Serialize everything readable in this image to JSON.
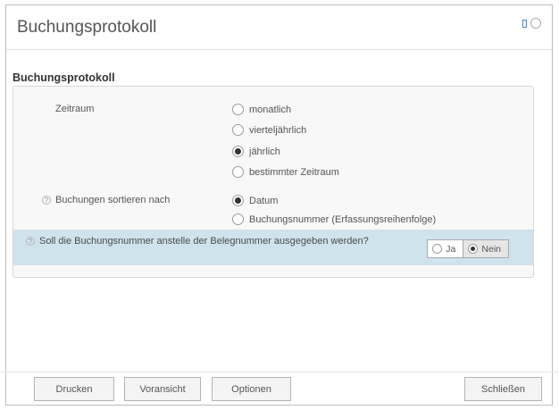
{
  "window": {
    "title": "Buchungsprotokoll"
  },
  "section": {
    "title": "Buchungsprotokoll"
  },
  "zeitraum": {
    "label": "Zeitraum",
    "options": [
      {
        "label": "monatlich",
        "checked": false
      },
      {
        "label": "vierteljährlich",
        "checked": false
      },
      {
        "label": "jährlich",
        "checked": true
      },
      {
        "label": "bestimmter Zeitraum",
        "checked": false
      }
    ]
  },
  "sortierung": {
    "label": "Buchungen sortieren nach",
    "options": [
      {
        "label": "Datum",
        "checked": true
      },
      {
        "label": "Buchungsnummer (Erfassungsreihenfolge)",
        "checked": false
      }
    ]
  },
  "question": {
    "text": "Soll die Buchungsnummer anstelle der Belegnummer ausgegeben werden?",
    "yes_label": "Ja",
    "no_label": "Nein",
    "selected": "Nein"
  },
  "buttons": {
    "print": "Drucken",
    "preview": "Voransicht",
    "options": "Optionen",
    "close": "Schließen"
  },
  "colors": {
    "highlight": "#cfe3ec",
    "accent": "#3c8bd0"
  }
}
